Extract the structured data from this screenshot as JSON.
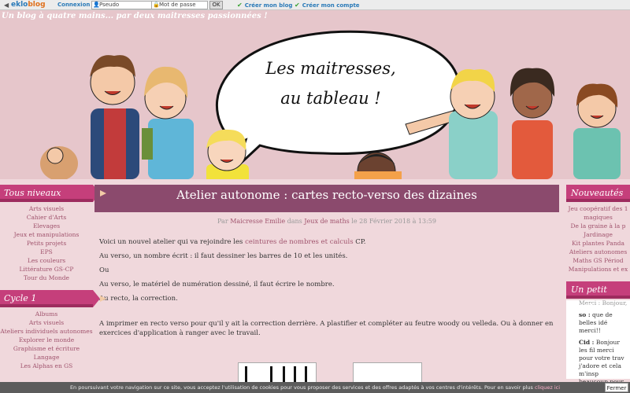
{
  "topbar": {
    "logo_a": "eklo",
    "logo_b": "blog",
    "login_label": "Connexion :",
    "pseudo_placeholder": "Pseudo",
    "password_placeholder": "Mot de passe",
    "ok_label": "OK",
    "create_blog": "Créer mon blog",
    "create_account": "Créer mon compte"
  },
  "header": {
    "tagline": "Un blog à quatre mains... par deux maitresses passionnées !",
    "bubble_line1": "Les maitresses,",
    "bubble_line2": "au tableau !"
  },
  "left": {
    "section1_title": "Tous niveaux",
    "section1_items": [
      "Arts visuels",
      "Cahier d'Arts",
      "Elevages",
      "Jeux et manipulations",
      "Petits projets",
      "EPS",
      "Les couleurs",
      "Littérature GS-CP",
      "Tour du Monde"
    ],
    "section2_title": "Cycle 1",
    "section2_items": [
      "Albums",
      "Arts visuels",
      "Ateliers individuels autonomes",
      "Explorer le monde",
      "Graphisme et écriture",
      "Langage",
      "Les Alphas en GS"
    ]
  },
  "post": {
    "title": "Atelier autonome : cartes recto-verso des dizaines",
    "meta_par": "Par",
    "meta_author": "Maicresse Emilie",
    "meta_dans": "dans",
    "meta_category": "Jeux de maths",
    "meta_date": "le 28 Février 2018 à 13:59",
    "p1_a": "Voici un nouvel atelier qui va rejoindre les ",
    "p1_link": "ceintures de nombres et calculs",
    "p1_b": " CP.",
    "p2": "Au verso, un nombre écrit : il faut dessiner les barres de 10 et les unités.",
    "p3": "Ou",
    "p4": "Au verso, le matériel de numération dessiné, il faut écrire le nombre.",
    "p5": "Au recto, la correction.",
    "p6": "A imprimer en recto verso pour qu'il y ait la correction derrière. A plastifier et compléter au feutre woody ou velleda. Ou à donner en exercices d'application à ranger avec le travail."
  },
  "right": {
    "section1_title": "Nouveautés",
    "section1_items": [
      "Jeu coopératif des 1",
      "magiques",
      "De la graine à la p",
      "Jardinage",
      "Kit plantes Panda",
      "Ateliers autonomes",
      "Maths GS Périod",
      "Manipulations et ex"
    ],
    "section2_title": "Un petit mot?",
    "comments": [
      {
        "name": "so :",
        "text": " que de belles idé merci!!"
      },
      {
        "name": "Cid :",
        "text": " Bonjour les fil merci pour votre trav j'adore et cela m'insp beaucoup pour mes a"
      }
    ],
    "comment_partial": "Merci : Bonjour,"
  },
  "cookie": {
    "text": "En poursuivant votre navigation sur ce site, vous acceptez l'utilisation de cookies pour vous proposer des services et des offres adaptés à vos centres d'intérêts. Pour en savoir plus ",
    "link": "cliquez ici",
    "button": "Fermer"
  }
}
